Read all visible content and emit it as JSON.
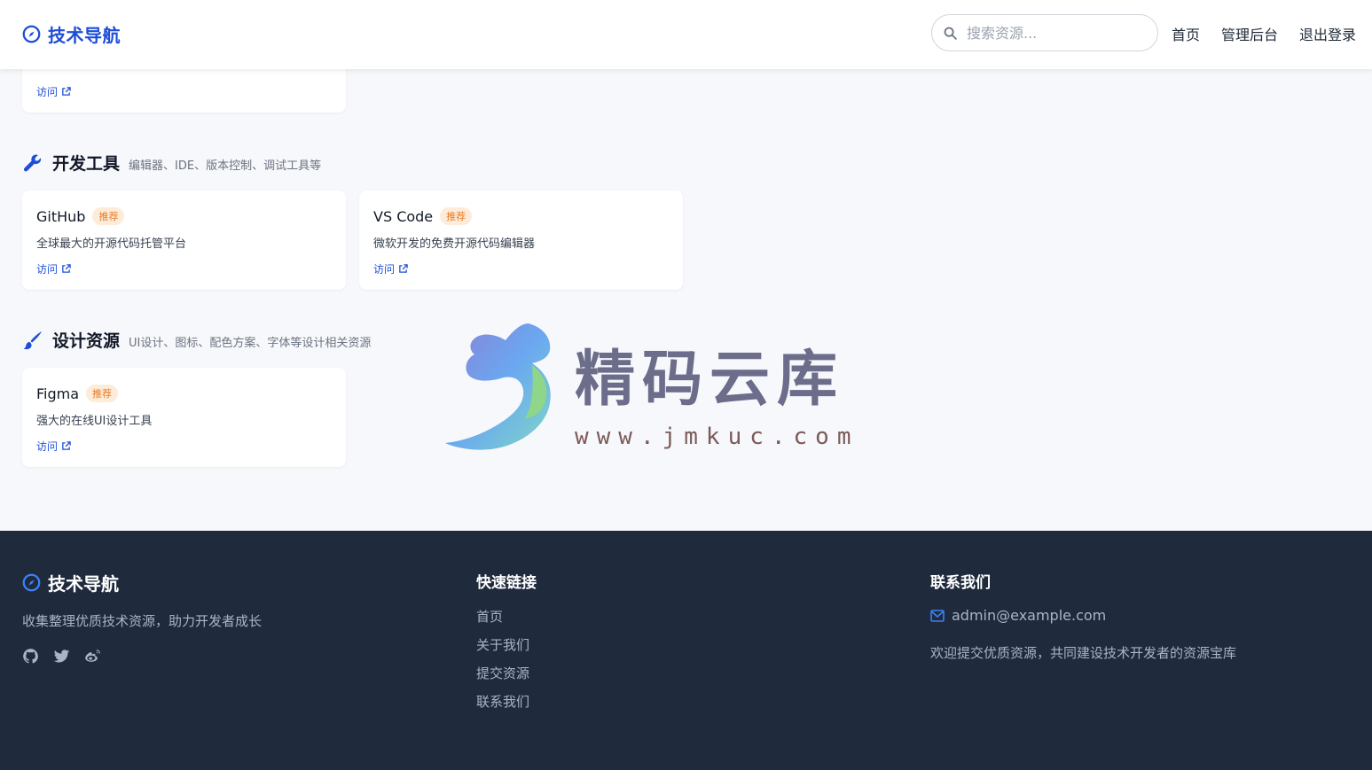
{
  "header": {
    "brand": "技术导航",
    "search_placeholder": "搜索资源...",
    "nav": {
      "home": "首页",
      "admin": "管理后台",
      "logout": "退出登录"
    }
  },
  "top_card": {
    "link": "访问"
  },
  "sections": [
    {
      "name": "开发工具",
      "desc": "编辑器、IDE、版本控制、调试工具等",
      "icon": "wrench-icon",
      "cards": [
        {
          "name": "GitHub",
          "badge": "推荐",
          "desc": "全球最大的开源代码托管平台",
          "link": "访问"
        },
        {
          "name": "VS Code",
          "badge": "推荐",
          "desc": "微软开发的免费开源代码编辑器",
          "link": "访问"
        }
      ]
    },
    {
      "name": "设计资源",
      "desc": "UI设计、图标、配色方案、字体等设计相关资源",
      "icon": "paintbrush-icon",
      "cards": [
        {
          "name": "Figma",
          "badge": "推荐",
          "desc": "强大的在线UI设计工具",
          "link": "访问"
        }
      ]
    }
  ],
  "watermark": {
    "text": "精码云库",
    "url": "www.jmkuc.com"
  },
  "footer": {
    "brand": "技术导航",
    "slogan": "收集整理优质技术资源，助力开发者成长",
    "quick_links_title": "快速链接",
    "quick_links": [
      "首页",
      "关于我们",
      "提交资源",
      "联系我们"
    ],
    "contact_title": "联系我们",
    "email": "admin@example.com",
    "welcome": "欢迎提交优质资源，共同建设技术开发者的资源宝库"
  },
  "colors": {
    "accent": "#1d4ed8",
    "badge_text": "#ea7a24",
    "badge_bg": "#fdecd9",
    "footer_bg": "#1f2a3d"
  }
}
